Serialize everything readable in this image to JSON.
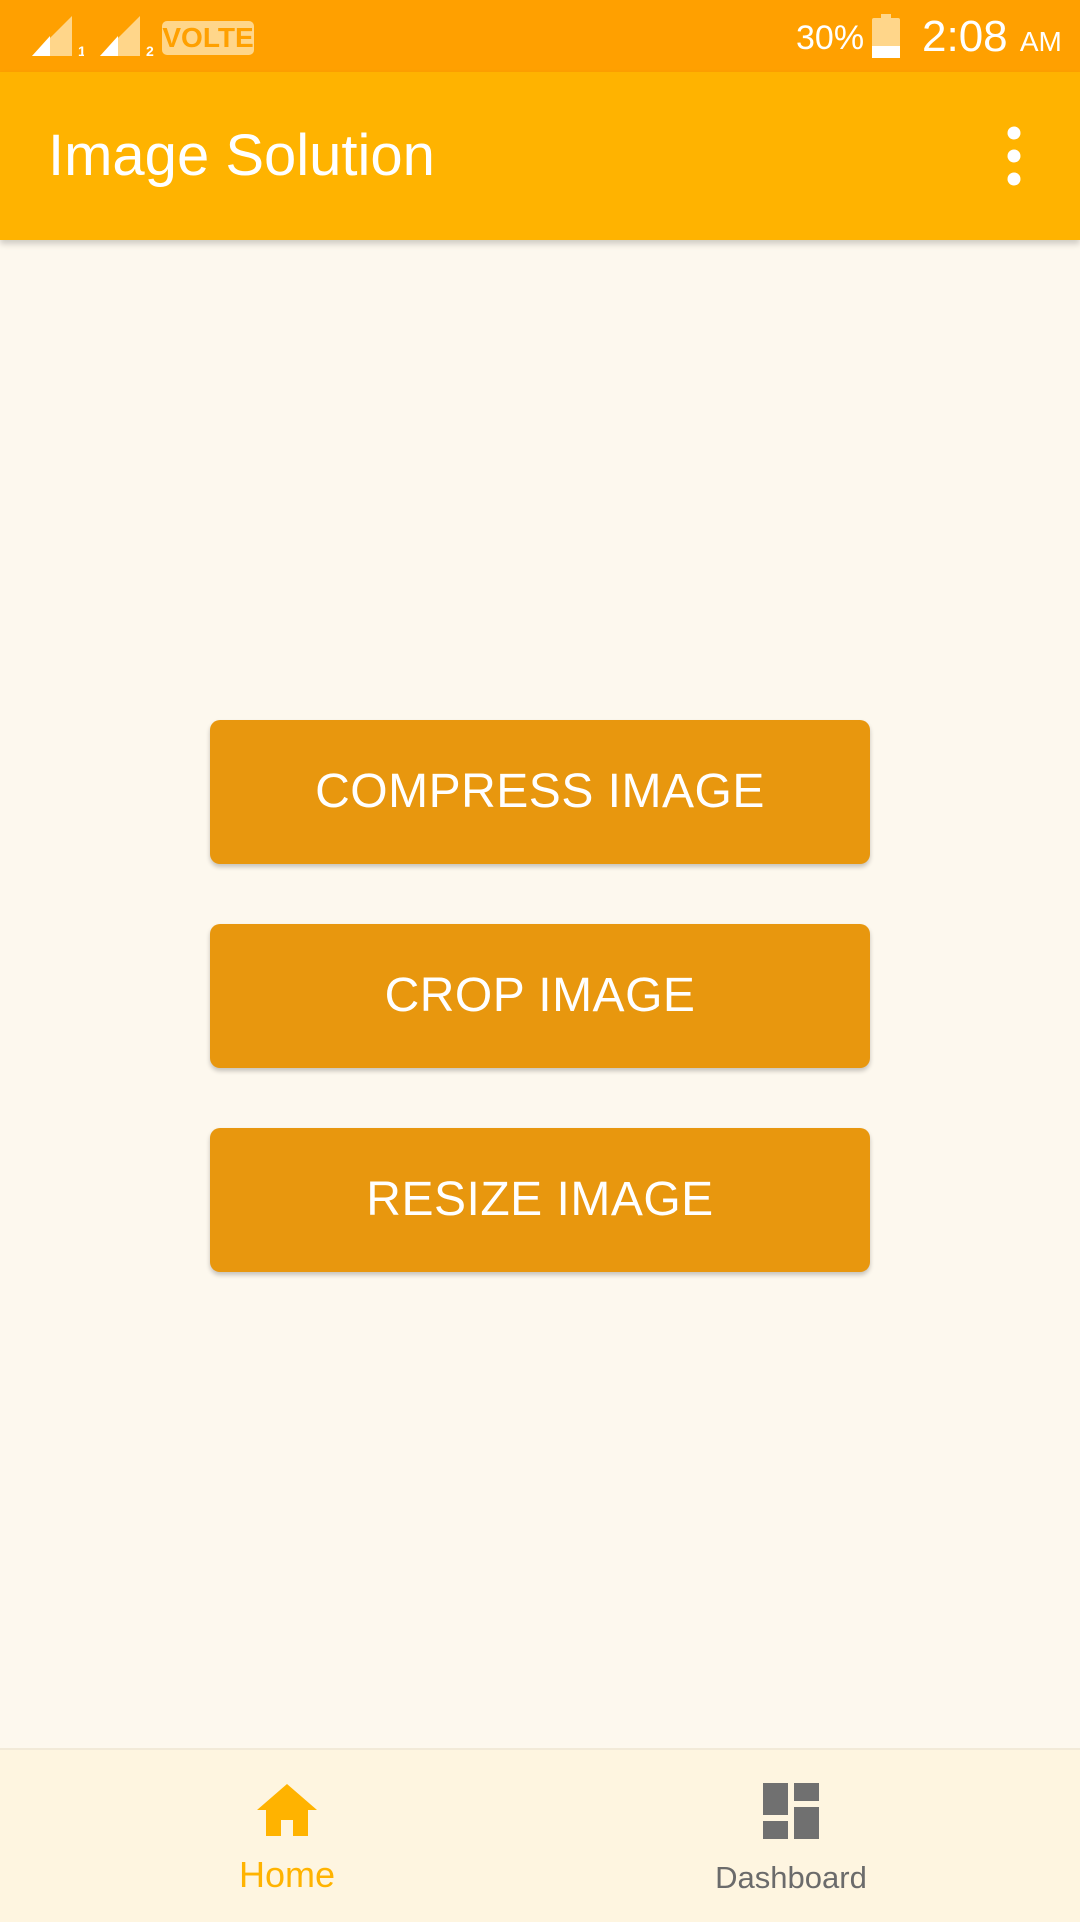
{
  "status_bar": {
    "sim1_label": "1",
    "sim2_label": "2",
    "volte": "VOLTE",
    "battery_percent": "30%",
    "battery_level": 0.3,
    "time": "2:08",
    "ampm": "AM",
    "icons": [
      "signal-sim1-icon",
      "signal-sim2-icon",
      "battery-icon"
    ]
  },
  "app_bar": {
    "title": "Image Solution",
    "overflow_icon": "more-vert-icon"
  },
  "actions": [
    {
      "label": "COMPRESS IMAGE"
    },
    {
      "label": "CROP IMAGE"
    },
    {
      "label": "RESIZE IMAGE"
    }
  ],
  "bottom_nav": {
    "items": [
      {
        "label": "Home",
        "icon": "home-icon",
        "active": true
      },
      {
        "label": "Dashboard",
        "icon": "dashboard-icon",
        "active": false
      }
    ]
  },
  "colors": {
    "status_bar": "#FFA000",
    "app_bar": "#FFB300",
    "button": "#E8970E",
    "background": "#FDF8EE",
    "nav_background": "#FEF5E0",
    "nav_active": "#FFB300",
    "nav_inactive": "#6B6B6B"
  }
}
